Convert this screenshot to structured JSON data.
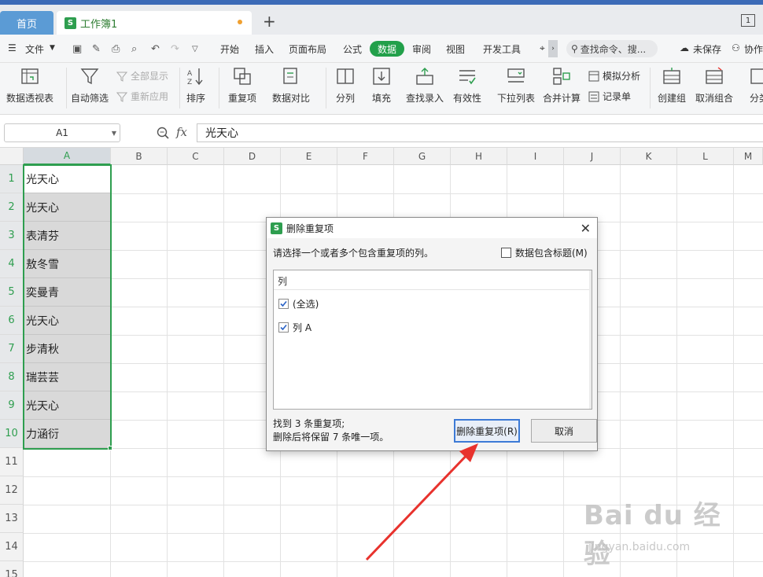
{
  "tabs": {
    "home": "首页",
    "workbook": "工作簿1",
    "new_tab": "+"
  },
  "menu": {
    "file": "文件",
    "items": [
      "开始",
      "插入",
      "页面布局",
      "公式",
      "数据",
      "审阅",
      "视图",
      "开发工具"
    ],
    "active": "数据",
    "search": "查找命令、搜...",
    "unsaved": "未保存",
    "collab": "协作"
  },
  "ribbon": {
    "pivot": "数据透视表",
    "autofilter": "自动筛选",
    "show_all": "全部显示",
    "reapply": "重新应用",
    "sort": "排序",
    "duplicates": "重复项",
    "compare": "数据对比",
    "split": "分列",
    "fill": "填充",
    "lookup": "查找录入",
    "validity": "有效性",
    "dropdown": "下拉列表",
    "consolidate": "合并计算",
    "whatif": "模拟分析",
    "record": "记录单",
    "group": "创建组",
    "ungroup": "取消组合",
    "subtotal": "分类"
  },
  "formula_bar": {
    "name_box": "A1",
    "fx": "fx",
    "content": "光天心"
  },
  "sheet": {
    "columns": [
      "A",
      "B",
      "C",
      "D",
      "E",
      "F",
      "G",
      "H",
      "I",
      "J",
      "K",
      "L",
      "M"
    ],
    "rows": [
      "1",
      "2",
      "3",
      "4",
      "5",
      "6",
      "7",
      "8",
      "9",
      "10",
      "11",
      "12",
      "13",
      "14",
      "15"
    ],
    "col_a": [
      "光天心",
      "光天心",
      "表清芬",
      "敖冬雪",
      "奕曼青",
      "光天心",
      "步清秋",
      "瑞芸芸",
      "光天心",
      "力涵衍"
    ]
  },
  "dialog": {
    "title": "删除重复项",
    "prompt": "请选择一个或者多个包含重复项的列。",
    "header_option": "数据包含标题(M)",
    "list_header": "列",
    "list_items": [
      "(全选)",
      "列 A"
    ],
    "info_line1": "找到 3 条重复项;",
    "info_line2": "删除后将保留 7 条唯一项。",
    "remove_button": "删除重复项(R)",
    "cancel_button": "取消"
  },
  "watermark": {
    "brand": "Bai du 经验",
    "url": "jingyan.baidu.com"
  },
  "colors": {
    "accent_green": "#2e9e4f",
    "data_tab": "#22a04a",
    "home_tab": "#5b9bd5",
    "arrow_red": "#e8322d"
  }
}
